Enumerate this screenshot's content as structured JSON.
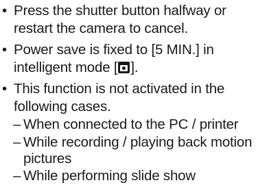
{
  "bullet_symbol": "•",
  "dash_symbol": "–",
  "items": [
    {
      "line1": "Press the shutter button halfway or",
      "line2": "restart the camera to cancel."
    },
    {
      "line1": "Power save is fixed to [5 MIN.] in",
      "line2_before": "intelligent mode [",
      "line2_icon": "intelligent-auto-mode-icon",
      "line2_after": "]."
    },
    {
      "line1": "This function is not activated in the",
      "line2": "following cases.",
      "subitems": [
        {
          "line1": "When connected to the PC / printer"
        },
        {
          "line1": "While recording / playing back motion",
          "line2": "pictures"
        },
        {
          "line1": "While performing slide show"
        }
      ]
    }
  ]
}
